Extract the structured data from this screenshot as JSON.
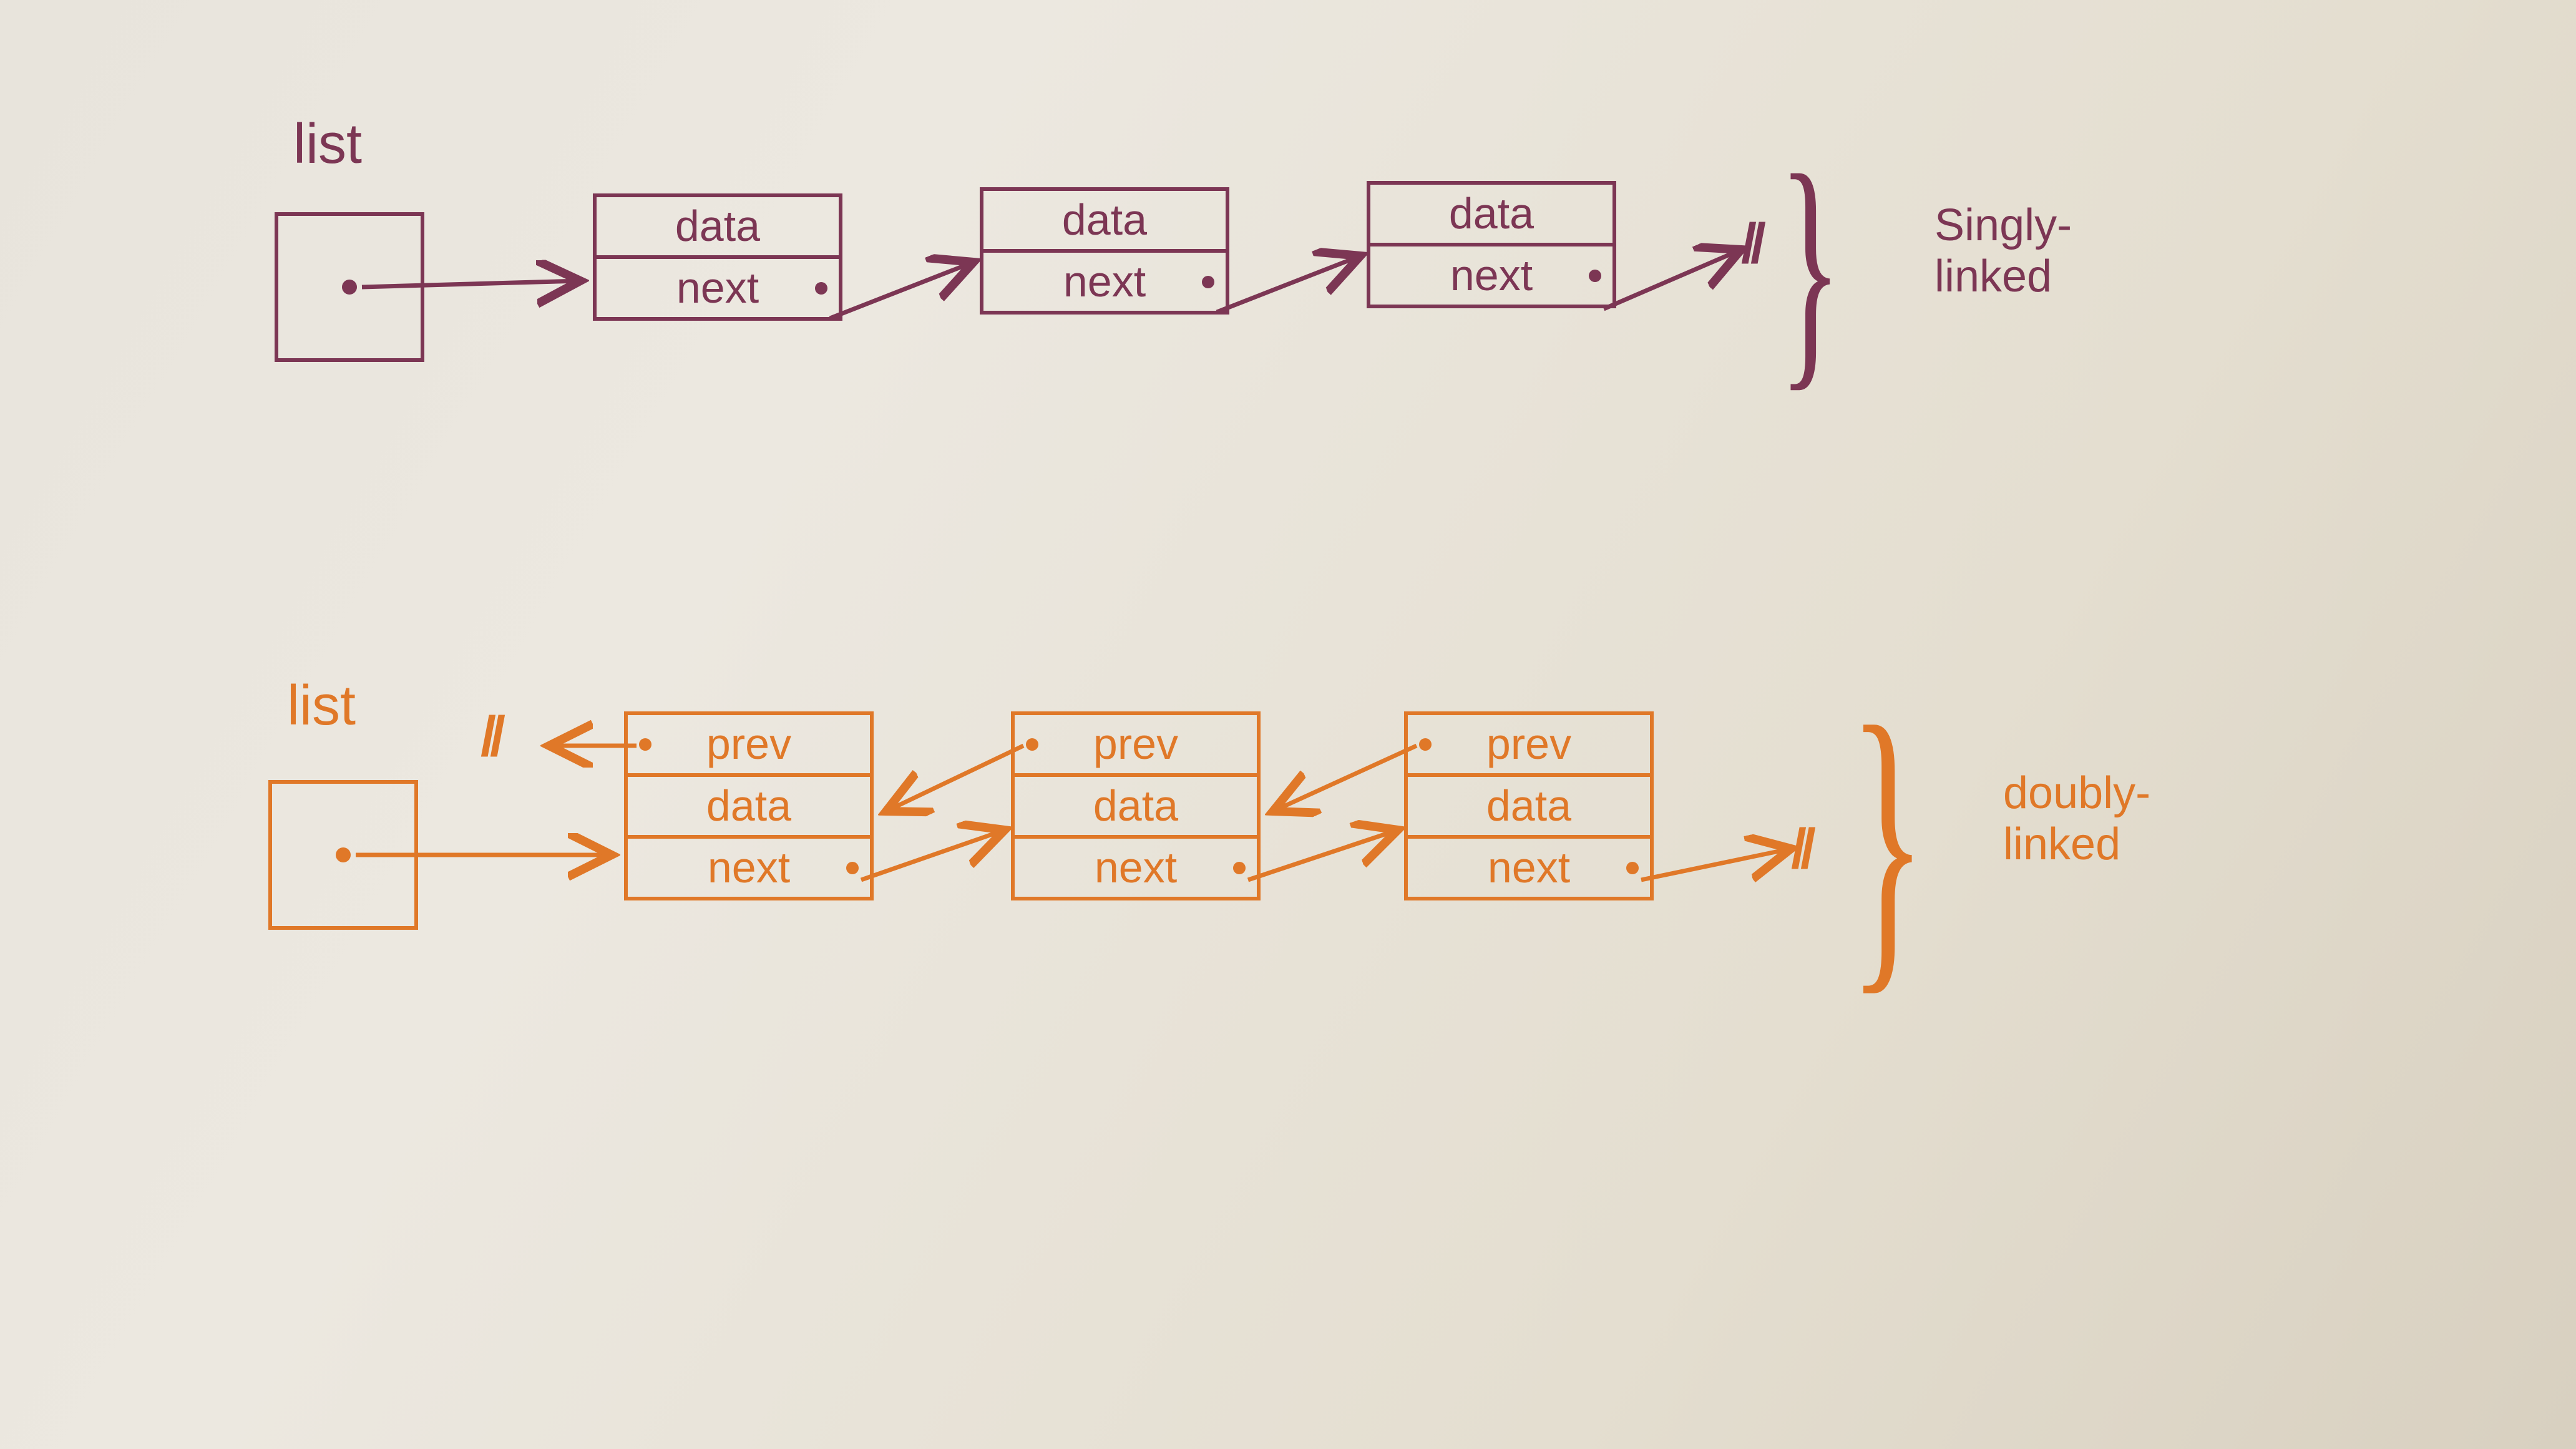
{
  "singly": {
    "title": "list",
    "nodes": [
      {
        "fields": [
          "data",
          "next"
        ]
      },
      {
        "fields": [
          "data",
          "next"
        ]
      },
      {
        "fields": [
          "data",
          "next"
        ]
      }
    ],
    "terminator": "//",
    "type_label": "Singly-\nlinked",
    "color": "#7c3654"
  },
  "doubly": {
    "title": "list",
    "nodes": [
      {
        "fields": [
          "prev",
          "data",
          "next"
        ]
      },
      {
        "fields": [
          "prev",
          "data",
          "next"
        ]
      },
      {
        "fields": [
          "prev",
          "data",
          "next"
        ]
      }
    ],
    "terminator_prev": "//",
    "terminator_next": "//",
    "type_label": "doubly-\nlinked",
    "color": "#e07828"
  }
}
